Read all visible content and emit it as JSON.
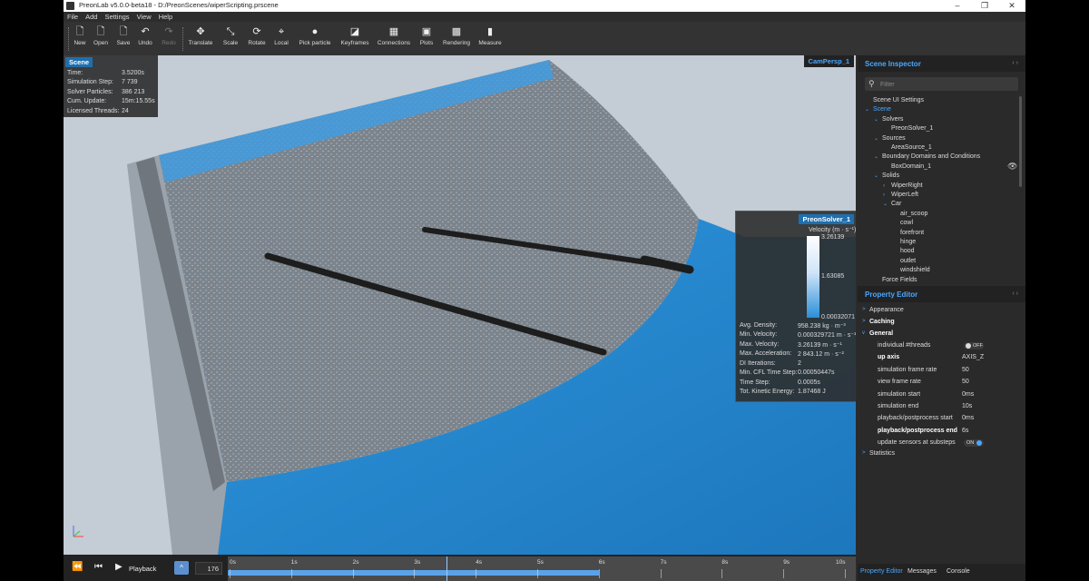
{
  "window": {
    "title": "PreonLab v5.0.0-beta18 - D:/PreonScenes/wiperScripting.prscene"
  },
  "menu": [
    "File",
    "Add",
    "Settings",
    "View",
    "Help"
  ],
  "toolbar": {
    "new": "New",
    "open": "Open",
    "save": "Save",
    "undo": "Undo",
    "redo": "Redo",
    "translate": "Translate",
    "scale": "Scale",
    "rotate": "Rotate",
    "local": "Local",
    "pick_particle": "Pick particle",
    "keyframes": "Keyframes",
    "connections": "Connections",
    "plots": "Plots",
    "rendering": "Rendering",
    "measure": "Measure"
  },
  "scene_box": {
    "title": "Scene",
    "rows": [
      {
        "label": "Time:",
        "value": "3.5200s"
      },
      {
        "label": "Simulation Step:",
        "value": "7 739"
      },
      {
        "label": "Solver Particles:",
        "value": "386 213"
      },
      {
        "label": "Cum. Update:",
        "value": "15m:15.55s"
      },
      {
        "label": "Licensed Threads:",
        "value": "24"
      }
    ]
  },
  "camera_label": "CamPersp_1",
  "solver_box": {
    "title": "PreonSolver_1",
    "legend_title": "Velocity (m · s⁻¹)",
    "legend_max": "3.26139",
    "legend_mid": "1.63085",
    "legend_min": "0.00032071",
    "stats": [
      {
        "label": "Avg. Density:",
        "value": "958.238 kg · m⁻³"
      },
      {
        "label": "Min. Velocity:",
        "value": "0.000329721 m · s⁻¹"
      },
      {
        "label": "Max. Velocity:",
        "value": "3.26139 m · s⁻¹"
      },
      {
        "label": "Max. Acceleration:",
        "value": "2 843.12 m · s⁻²"
      },
      {
        "label": "DI Iterations:",
        "value": "2"
      },
      {
        "label": "Min. CFL Time Step:",
        "value": "0.00050447s"
      },
      {
        "label": "Time Step:",
        "value": "0.0005s"
      },
      {
        "label": "Tot. Kinetic Energy:",
        "value": "1.87468 J"
      }
    ]
  },
  "timeline": {
    "play_label": "Playback",
    "frame": "176",
    "ticks": [
      "0s",
      "1s",
      "2s",
      "3s",
      "4s",
      "5s",
      "6s",
      "7s",
      "8s",
      "9s",
      "10s"
    ],
    "progress": 0.6,
    "cursor_time": 3.52
  },
  "inspector": {
    "title": "Scene Inspector",
    "filter_placeholder": "Filter",
    "tree": [
      {
        "label": "Scene UI Settings",
        "depth": 0,
        "arrow": ""
      },
      {
        "label": "Scene",
        "depth": 0,
        "arrow": "v",
        "selected": true
      },
      {
        "label": "Solvers",
        "depth": 1,
        "arrow": "v"
      },
      {
        "label": "PreonSolver_1",
        "depth": 2,
        "arrow": ""
      },
      {
        "label": "Sources",
        "depth": 1,
        "arrow": "v"
      },
      {
        "label": "AreaSource_1",
        "depth": 2,
        "arrow": ""
      },
      {
        "label": "Boundary Domains and Conditions",
        "depth": 1,
        "arrow": "v"
      },
      {
        "label": "BoxDomain_1",
        "depth": 2,
        "arrow": ""
      },
      {
        "label": "Solids",
        "depth": 1,
        "arrow": "v"
      },
      {
        "label": "WiperRight",
        "depth": 2,
        "arrow": ">"
      },
      {
        "label": "WiperLeft",
        "depth": 2,
        "arrow": ">"
      },
      {
        "label": "Car",
        "depth": 2,
        "arrow": "v"
      },
      {
        "label": "air_scoop",
        "depth": 3,
        "arrow": ""
      },
      {
        "label": "cowl",
        "depth": 3,
        "arrow": ""
      },
      {
        "label": "forefront",
        "depth": 3,
        "arrow": ""
      },
      {
        "label": "hinge",
        "depth": 3,
        "arrow": ""
      },
      {
        "label": "hood",
        "depth": 3,
        "arrow": ""
      },
      {
        "label": "outlet",
        "depth": 3,
        "arrow": ""
      },
      {
        "label": "windshield",
        "depth": 3,
        "arrow": ""
      },
      {
        "label": "Force Fields",
        "depth": 1,
        "arrow": ""
      }
    ]
  },
  "property_editor": {
    "title": "Property Editor",
    "sections": {
      "appearance": "Appearance",
      "caching": "Caching",
      "general": "General",
      "statistics": "Statistics"
    },
    "props": [
      {
        "name": "individual #threads",
        "value": "OFF",
        "type": "toggle-off",
        "bold": false
      },
      {
        "name": "up axis",
        "value": "AXIS_Z",
        "type": "text",
        "bold": true
      },
      {
        "name": "simulation frame rate",
        "value": "50",
        "type": "text",
        "bold": false
      },
      {
        "name": "view frame rate",
        "value": "50",
        "type": "text",
        "bold": false
      },
      {
        "name": "simulation start",
        "value": "0ms",
        "type": "text",
        "bold": false
      },
      {
        "name": "simulation end",
        "value": "10s",
        "type": "text",
        "bold": false
      },
      {
        "name": "playback/postprocess start",
        "value": "0ms",
        "type": "text",
        "bold": false
      },
      {
        "name": "playback/postprocess end",
        "value": "6s",
        "type": "text",
        "bold": true
      },
      {
        "name": "update sensors at substeps",
        "value": "ON",
        "type": "toggle-on",
        "bold": false
      }
    ]
  },
  "bottom_tabs": [
    "Property Editor",
    "Messages",
    "Console"
  ],
  "colors": {
    "accent": "#4aa8ff",
    "fluid": "#2a8fd8",
    "panel": "#2a2a2a"
  }
}
